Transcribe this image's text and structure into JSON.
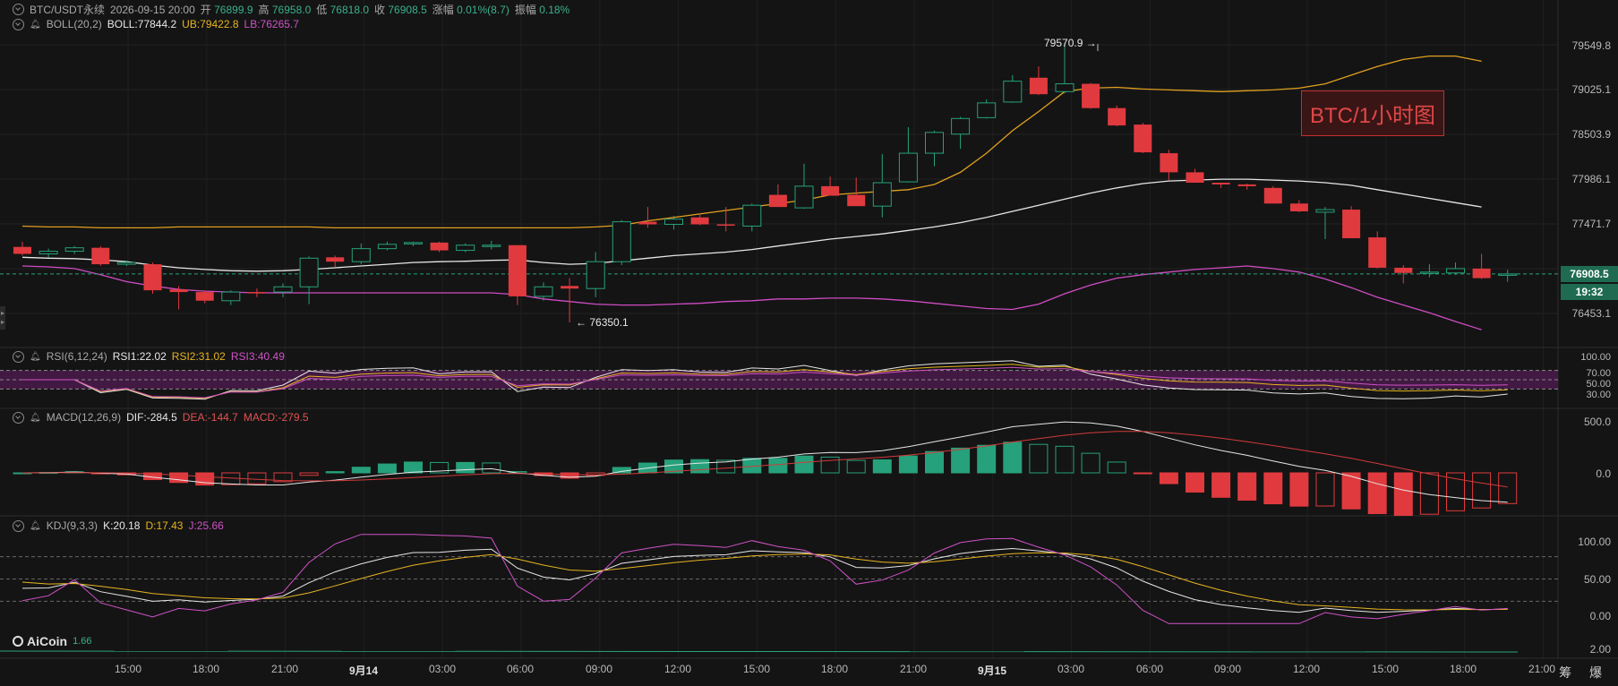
{
  "header": {
    "symbol": "BTC/USDT永续",
    "datetime": "2026-09-15 20:00",
    "open_label": "开",
    "open": "76899.9",
    "high_label": "高",
    "high": "76958.0",
    "low_label": "低",
    "low": "76818.0",
    "close_label": "收",
    "close": "76908.5",
    "change_label": "涨幅",
    "change": "0.01%(8.7)",
    "amp_label": "振幅",
    "amp": "0.18%"
  },
  "boll": {
    "name": "BOLL(20,2)",
    "mid": "BOLL:77844.2",
    "ub": "UB:79422.8",
    "lb": "LB:76265.7"
  },
  "rsi": {
    "name": "RSI(6,12,24)",
    "r1": "RSI1:22.02",
    "r2": "RSI2:31.02",
    "r3": "RSI3:40.49"
  },
  "macd": {
    "name": "MACD(12,26,9)",
    "dif": "DIF:-284.5",
    "dea": "DEA:-144.7",
    "macd": "MACD:-279.5"
  },
  "kdj": {
    "name": "KDJ(9,3,3)",
    "k": "K:20.18",
    "d": "D:17.43",
    "j": "J:25.66"
  },
  "price_axis": [
    "79549.8",
    "79025.1",
    "78503.9",
    "77986.1",
    "77471.7",
    "76453.1"
  ],
  "current_price": "76908.5",
  "countdown": "19:32",
  "high_marker": "79570.9",
  "low_marker": "76350.1",
  "rsi_axis": [
    "100.00",
    "70.00",
    "50.00",
    "30.00"
  ],
  "macd_axis": [
    "500.0",
    "0.0"
  ],
  "kdj_axis": [
    "100.00",
    "50.00",
    "0.00",
    "2.00"
  ],
  "time_axis": [
    "15:00",
    "18:00",
    "21:00",
    "9月14",
    "03:00",
    "06:00",
    "09:00",
    "12:00",
    "15:00",
    "18:00",
    "21:00",
    "9月15",
    "03:00",
    "06:00",
    "09:00",
    "12:00",
    "15:00",
    "18:00",
    "21:00"
  ],
  "chart_title": "BTC/1小时图",
  "logo_text": "AiCoin",
  "logo_sub": "1.66",
  "corner": "筹 爆",
  "colors": {
    "up": "#26a17b",
    "down": "#e03a3e",
    "boll_mid": "#e6e6e6",
    "boll_ub": "#e0a020",
    "boll_lb": "#d04cc4"
  },
  "chart_data": {
    "type": "candlestick",
    "interval": "1h",
    "ohlc": [
      [
        77220,
        77280,
        77120,
        77140
      ],
      [
        77140,
        77200,
        77100,
        77170
      ],
      [
        77170,
        77230,
        77140,
        77210
      ],
      [
        77210,
        77230,
        77000,
        77020
      ],
      [
        77020,
        77060,
        77000,
        77040
      ],
      [
        77020,
        77040,
        76680,
        76720
      ],
      [
        76730,
        76770,
        76500,
        76700
      ],
      [
        76700,
        76720,
        76570,
        76600
      ],
      [
        76600,
        76720,
        76550,
        76700
      ],
      [
        76700,
        76740,
        76640,
        76690
      ],
      [
        76700,
        76800,
        76640,
        76760
      ],
      [
        76760,
        77110,
        76560,
        77090
      ],
      [
        77100,
        77120,
        76990,
        77050
      ],
      [
        77050,
        77260,
        77020,
        77200
      ],
      [
        77200,
        77280,
        77180,
        77250
      ],
      [
        77260,
        77280,
        77230,
        77270
      ],
      [
        77270,
        77280,
        77160,
        77180
      ],
      [
        77180,
        77260,
        77160,
        77240
      ],
      [
        77240,
        77290,
        77190,
        77240
      ],
      [
        77240,
        77240,
        76550,
        76650
      ],
      [
        76650,
        76810,
        76600,
        76760
      ],
      [
        76770,
        76860,
        76350,
        76740
      ],
      [
        76740,
        77160,
        76640,
        77050
      ],
      [
        77050,
        77530,
        77010,
        77510
      ],
      [
        77510,
        77680,
        77440,
        77480
      ],
      [
        77480,
        77580,
        77420,
        77540
      ],
      [
        77560,
        77610,
        77470,
        77480
      ],
      [
        77480,
        77680,
        77400,
        77470
      ],
      [
        77460,
        77720,
        77400,
        77700
      ],
      [
        77820,
        77940,
        77680,
        77680
      ],
      [
        77670,
        78180,
        77660,
        77920
      ],
      [
        77920,
        78030,
        77820,
        77810
      ],
      [
        77820,
        78020,
        77690,
        77690
      ],
      [
        77690,
        78290,
        77560,
        77960
      ],
      [
        77970,
        78600,
        77960,
        78300
      ],
      [
        78300,
        78560,
        78150,
        78540
      ],
      [
        78520,
        78720,
        78350,
        78700
      ],
      [
        78710,
        78920,
        78700,
        78880
      ],
      [
        78890,
        79200,
        78880,
        79130
      ],
      [
        79170,
        79300,
        78970,
        78980
      ],
      [
        79010,
        79570,
        78990,
        79100
      ],
      [
        79100,
        79110,
        78810,
        78820
      ],
      [
        78820,
        78850,
        78610,
        78620
      ],
      [
        78630,
        78650,
        78300,
        78310
      ],
      [
        78300,
        78340,
        77990,
        78080
      ],
      [
        78080,
        78120,
        77960,
        77960
      ],
      [
        77960,
        77960,
        77900,
        77940
      ],
      [
        77940,
        77950,
        77880,
        77920
      ],
      [
        77900,
        77920,
        77720,
        77720
      ],
      [
        77720,
        77760,
        77620,
        77630
      ],
      [
        77620,
        77680,
        77310,
        77650
      ],
      [
        77650,
        77690,
        77320,
        77320
      ],
      [
        77330,
        77400,
        76970,
        76980
      ],
      [
        76980,
        77010,
        76800,
        76920
      ],
      [
        76920,
        77020,
        76870,
        76930
      ],
      [
        76920,
        77040,
        76900,
        76970
      ],
      [
        76970,
        77140,
        76850,
        76860
      ],
      [
        76900,
        76958,
        76818,
        76908
      ]
    ],
    "boll_mid": [
      77100,
      77090,
      77085,
      77070,
      77050,
      77010,
      76980,
      76960,
      76945,
      76940,
      76945,
      76960,
      76980,
      77000,
      77020,
      77040,
      77050,
      77055,
      77065,
      77070,
      77040,
      77020,
      77030,
      77060,
      77090,
      77120,
      77140,
      77160,
      77190,
      77230,
      77270,
      77310,
      77340,
      77370,
      77410,
      77450,
      77500,
      77560,
      77630,
      77700,
      77770,
      77840,
      77900,
      77950,
      77980,
      77990,
      78000,
      78000,
      77990,
      77980,
      77960,
      77930,
      77880,
      77830,
      77780,
      77730,
      77680
    ],
    "boll_ub": [
      77460,
      77450,
      77450,
      77440,
      77440,
      77440,
      77450,
      77450,
      77450,
      77450,
      77450,
      77450,
      77440,
      77440,
      77440,
      77440,
      77440,
      77440,
      77440,
      77440,
      77440,
      77440,
      77450,
      77470,
      77520,
      77560,
      77600,
      77640,
      77680,
      77720,
      77760,
      77820,
      77840,
      77860,
      77880,
      77940,
      78080,
      78300,
      78560,
      78780,
      79010,
      79050,
      79060,
      79040,
      79030,
      79020,
      79010,
      79020,
      79030,
      79050,
      79100,
      79200,
      79300,
      79380,
      79420,
      79420,
      79360
    ],
    "boll_lb": [
      77000,
      76990,
      76970,
      76900,
      76820,
      76770,
      76730,
      76710,
      76700,
      76690,
      76690,
      76690,
      76690,
      76690,
      76690,
      76690,
      76690,
      76690,
      76690,
      76670,
      76620,
      76590,
      76560,
      76550,
      76550,
      76560,
      76570,
      76590,
      76600,
      76620,
      76620,
      76630,
      76630,
      76620,
      76600,
      76570,
      76540,
      76510,
      76500,
      76560,
      76680,
      76780,
      76860,
      76900,
      76930,
      76960,
      76980,
      77000,
      76970,
      76930,
      76850,
      76750,
      76640,
      76550,
      76460,
      76360,
      76265
    ]
  }
}
